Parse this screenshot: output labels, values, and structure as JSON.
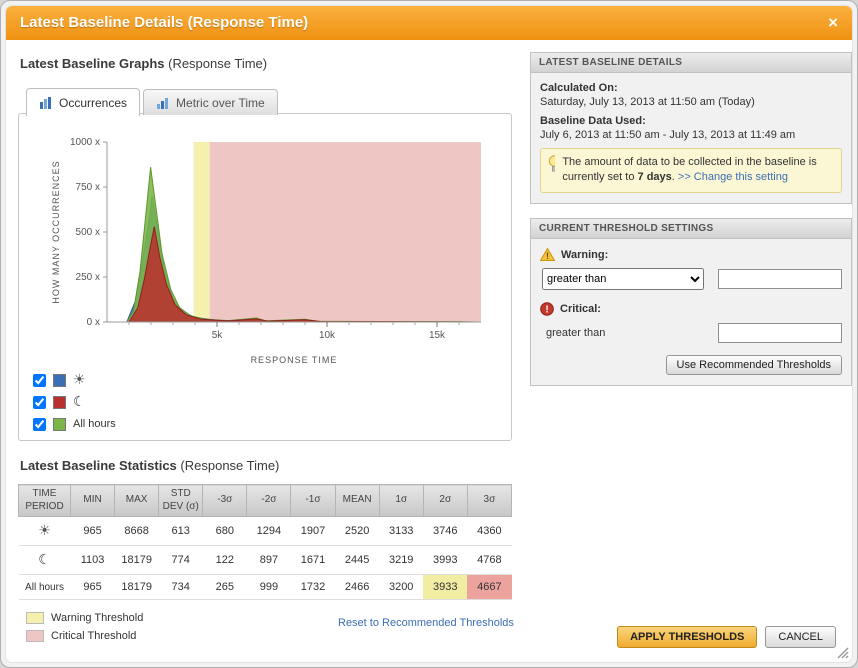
{
  "dialog": {
    "title": "Latest Baseline Details (Response Time)",
    "close_label": "×"
  },
  "graphs_section": {
    "heading_bold": "Latest Baseline Graphs",
    "heading_normal": " (Response Time)",
    "tabs": [
      {
        "label": "Occurrences"
      },
      {
        "label": "Metric over Time"
      }
    ],
    "legend": [
      {
        "name": "day",
        "color": "#3a6fb7",
        "icon": "sun-icon",
        "label": ""
      },
      {
        "name": "night",
        "color": "#b8312f",
        "icon": "moon-icon",
        "label": ""
      },
      {
        "name": "all-hours",
        "color": "#7ab648",
        "icon": "",
        "label": "All hours"
      }
    ]
  },
  "chart_data": {
    "type": "area",
    "title": "",
    "xlabel": "RESPONSE TIME",
    "ylabel": "HOW MANY OCCURRENCES",
    "xlim": [
      0,
      17000
    ],
    "ylim": [
      0,
      1000
    ],
    "x_ticks": [
      {
        "value": 5000,
        "label": "5k"
      },
      {
        "value": 10000,
        "label": "10k"
      },
      {
        "value": 15000,
        "label": "15k"
      }
    ],
    "y_ticks": [
      {
        "value": 0,
        "label": "0 x"
      },
      {
        "value": 250,
        "label": "250 x"
      },
      {
        "value": 500,
        "label": "500 x"
      },
      {
        "value": 750,
        "label": "750 x"
      },
      {
        "value": 1000,
        "label": "1000 x"
      }
    ],
    "bands": [
      {
        "name": "warning-threshold",
        "from": 3933,
        "to": 4667,
        "color": "#f5f0ae"
      },
      {
        "name": "critical-threshold",
        "from": 4667,
        "to": 17000,
        "color": "#eec7c4"
      }
    ],
    "series": [
      {
        "name": "Day",
        "color": "#3a6fb7",
        "stroke": "#2b5a99",
        "points": [
          [
            900,
            0
          ],
          [
            1300,
            120
          ],
          [
            1600,
            330
          ],
          [
            1900,
            560
          ],
          [
            2050,
            700
          ],
          [
            2300,
            520
          ],
          [
            2600,
            300
          ],
          [
            3000,
            130
          ],
          [
            3400,
            60
          ],
          [
            4000,
            25
          ],
          [
            5000,
            10
          ],
          [
            6000,
            5
          ],
          [
            8000,
            4
          ],
          [
            8668,
            0
          ]
        ]
      },
      {
        "name": "All hours",
        "color": "#7ab648",
        "stroke": "#5f9630",
        "points": [
          [
            900,
            0
          ],
          [
            1200,
            60
          ],
          [
            1500,
            280
          ],
          [
            1800,
            640
          ],
          [
            1980,
            860
          ],
          [
            2200,
            660
          ],
          [
            2500,
            380
          ],
          [
            2900,
            180
          ],
          [
            3300,
            80
          ],
          [
            3800,
            35
          ],
          [
            4500,
            15
          ],
          [
            5500,
            8
          ],
          [
            6800,
            22
          ],
          [
            7200,
            6
          ],
          [
            9000,
            15
          ],
          [
            9600,
            4
          ],
          [
            12000,
            3
          ],
          [
            16000,
            2
          ],
          [
            16800,
            0
          ]
        ]
      },
      {
        "name": "Night",
        "color": "#b8312f",
        "stroke": "#8f201e",
        "points": [
          [
            1000,
            0
          ],
          [
            1400,
            80
          ],
          [
            1700,
            240
          ],
          [
            2000,
            440
          ],
          [
            2150,
            530
          ],
          [
            2400,
            360
          ],
          [
            2700,
            210
          ],
          [
            3100,
            95
          ],
          [
            3600,
            40
          ],
          [
            4300,
            15
          ],
          [
            5500,
            6
          ],
          [
            6800,
            17
          ],
          [
            7300,
            5
          ],
          [
            9000,
            12
          ],
          [
            9700,
            3
          ],
          [
            12000,
            2
          ],
          [
            16900,
            0
          ]
        ]
      }
    ],
    "legend_position": "bottom-left",
    "grid": false
  },
  "stats_section": {
    "heading_bold": "Latest Baseline Statistics",
    "heading_normal": " (Response Time)",
    "table": {
      "headers": [
        "TIME PERIOD",
        "MIN",
        "MAX",
        "STD DEV (σ)",
        "-3σ",
        "-2σ",
        "-1σ",
        "MEAN",
        "1σ",
        "2σ",
        "3σ"
      ],
      "rows": [
        {
          "icon": "sun",
          "label": "",
          "values": [
            965,
            8668,
            613,
            680,
            1294,
            1907,
            2520,
            3133,
            3746,
            4360
          ]
        },
        {
          "icon": "moon",
          "label": "",
          "values": [
            1103,
            18179,
            774,
            122,
            897,
            1671,
            2445,
            3219,
            3993,
            4768
          ]
        },
        {
          "icon": "",
          "label": "All hours",
          "values": [
            965,
            18179,
            734,
            265,
            999,
            1732,
            2466,
            3200,
            3933,
            4667
          ],
          "highlights": {
            "8": "warning",
            "9": "critical"
          }
        }
      ]
    },
    "legend": [
      {
        "label": "Warning Threshold",
        "color": "#f5f0ae"
      },
      {
        "label": "Critical Threshold",
        "color": "#eec7c4"
      }
    ],
    "reset_link": "Reset to Recommended Thresholds"
  },
  "details_panel": {
    "title": "LATEST BASELINE DETAILS",
    "calculated_on_label": "Calculated On:",
    "calculated_on_value": "Saturday, July 13, 2013 at 11:50 am (Today)",
    "baseline_data_label": "Baseline Data Used:",
    "baseline_data_value": "July 6, 2013 at 11:50 am - July 13, 2013 at 11:49 am",
    "note_text_1": "The amount of data to be collected in the baseline is currently set to ",
    "note_days": "7 days",
    "note_text_2": ". ",
    "note_link": ">> Change this setting"
  },
  "threshold_panel": {
    "title": "CURRENT THRESHOLD SETTINGS",
    "warning_label": "Warning:",
    "warning_operator": "greater than",
    "warning_value": "",
    "critical_label": "Critical:",
    "critical_operator": "greater than",
    "critical_value": "",
    "recommend_button": "Use Recommended Thresholds"
  },
  "footer": {
    "apply_button": "APPLY THRESHOLDS",
    "cancel_button": "CANCEL"
  },
  "colors": {
    "accent": "#f29a11",
    "link": "#3b6fb5"
  }
}
